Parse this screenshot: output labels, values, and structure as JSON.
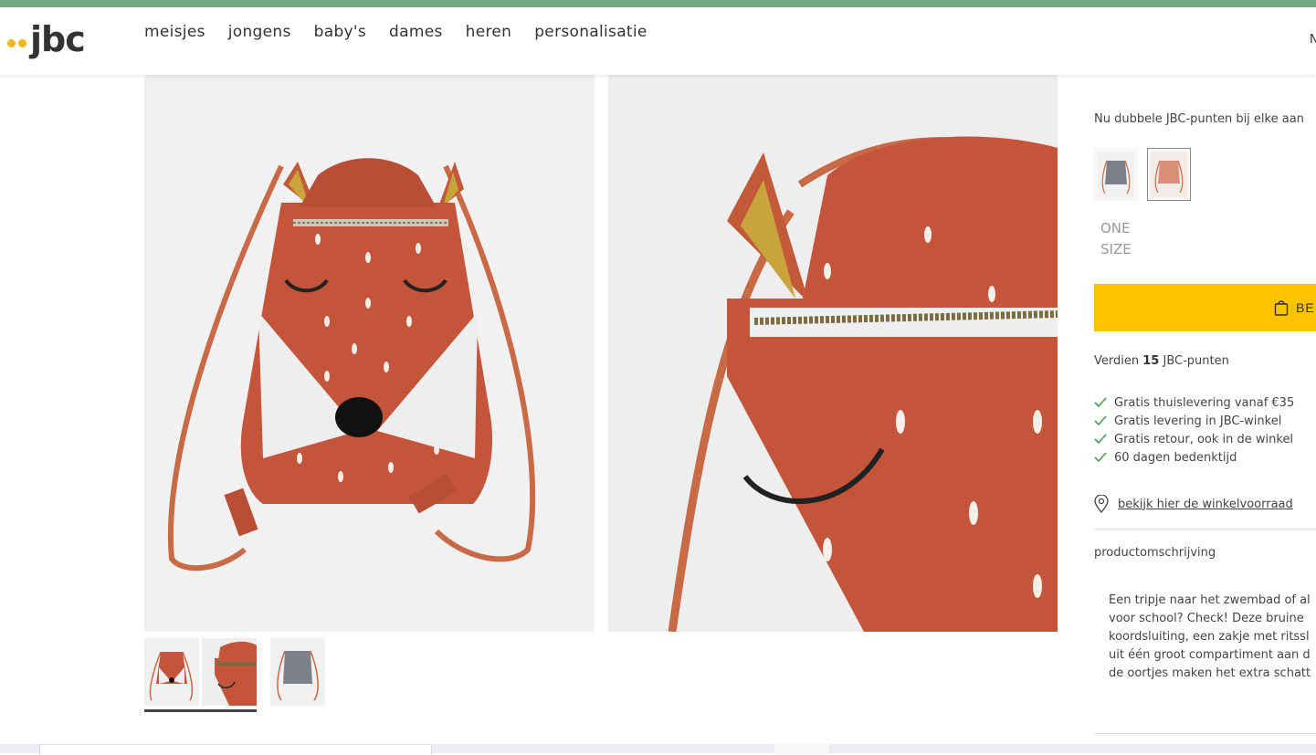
{
  "brand": {
    "logo_text": "jbc",
    "accent": "#f3b61f",
    "stripe_color": "#74a982"
  },
  "nav": {
    "items": [
      "meisjes",
      "jongens",
      "baby's",
      "dames",
      "heren",
      "personalisatie"
    ],
    "edge_text": "N"
  },
  "gallery": {
    "main_image": "fox-drawstring-bag-front",
    "zoom_image": "fox-drawstring-bag-detail",
    "thumbnails": [
      "fox-bag-front-thumb",
      "fox-bag-detail-thumb",
      "grey-bag-thumb"
    ]
  },
  "product": {
    "promo": "Nu dubbele JBC-punten bij elke aan",
    "swatches": [
      "grey-bag-swatch",
      "fox-bag-swatch"
    ],
    "size_line1": "ONE",
    "size_line2": "SIZE",
    "buy_label": "BE",
    "buy_color": "#fbc300",
    "points_prefix": "Verdien",
    "points_value": "15",
    "points_suffix": "JBC-punten",
    "usps": [
      "Gratis thuislevering vanaf €35",
      "Gratis levering in JBC-winkel",
      "Gratis retour, ook in de winkel",
      "60 dagen bedenktijd"
    ],
    "store_link": "bekijk hier de winkelvoorraad",
    "description_title": "productomschrijving",
    "description_lines": [
      "Een tripje naar het zwembad of al",
      "voor school? Check! Deze bruine",
      "koordsluiting, een zakje met ritssl",
      "uit één groot compartiment aan d",
      "de oortjes maken het extra schatt"
    ]
  }
}
